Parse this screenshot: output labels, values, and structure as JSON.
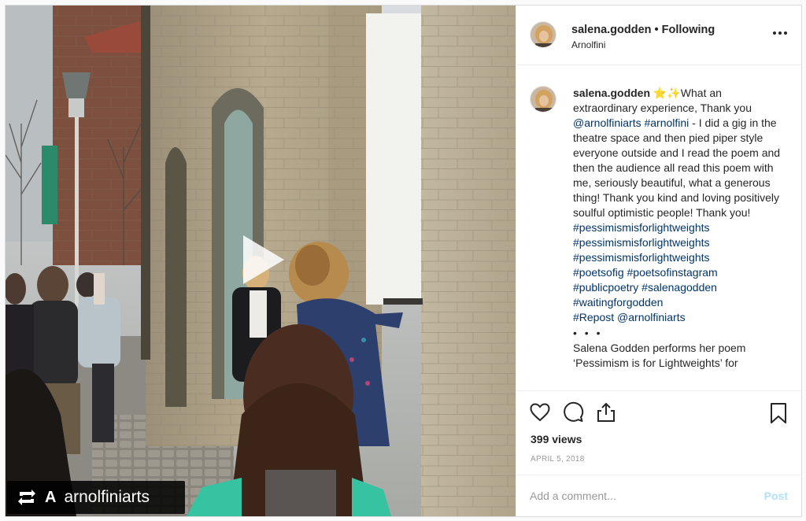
{
  "post": {
    "username": "salena.godden",
    "separator": "•",
    "follow_status": "Following",
    "location": "Arnolfini",
    "more_icon": "more-options-icon"
  },
  "media": {
    "type": "video",
    "play_icon": "play-icon",
    "repost_badge": {
      "icon": "repost-icon",
      "letter": "A",
      "username": "arnolfiniarts"
    }
  },
  "caption": {
    "username": "salena.godden",
    "emoji": "⭐✨",
    "text_a": "What an extraordinary experience, Thank you ",
    "mention_1": "@arnolfiniarts",
    "hashtag_1": "#arnolfini",
    "text_b": " - I did a gig in the theatre space and then pied piper style everyone outside and I read the poem and then the audience all read this poem with me, seriously beautiful, what a generous thing! Thank you kind and loving positively soulful optimistic people! Thank you!",
    "hashtags": [
      "#pessimismisforlightweights",
      "#pessimismisforlightweights",
      "#pessimismisforlightweights",
      "#poetsofig #poetsofinstagram",
      "#publicpoetry #salenagodden",
      "#waitingforgodden",
      "#Repost @arnolfiniarts"
    ],
    "ellipsis": "• • •",
    "second_para": "Salena Godden performs her poem ‘Pessimism is for Lightweights’ for"
  },
  "actions": {
    "like_icon": "heart-icon",
    "comment_icon": "comment-icon",
    "share_icon": "share-icon",
    "save_icon": "bookmark-icon",
    "views": "399 views",
    "date": "APRIL 5, 2018"
  },
  "comment_box": {
    "placeholder": "Add a comment...",
    "post_label": "Post"
  },
  "colors": {
    "link": "#003569",
    "muted": "#999999",
    "post_disabled": "#b2dffc",
    "border": "#efefef"
  }
}
